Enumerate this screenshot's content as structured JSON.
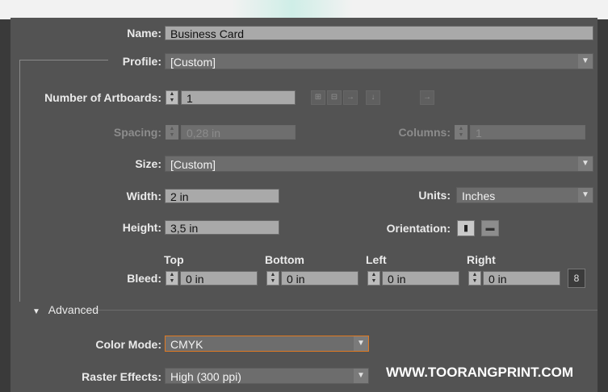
{
  "form": {
    "name": {
      "label": "Name:",
      "value": "Business Card"
    },
    "profile": {
      "label": "Profile:",
      "value": "[Custom]"
    },
    "artboards": {
      "label": "Number of Artboards:",
      "value": "1"
    },
    "spacing": {
      "label": "Spacing:",
      "value": "0,28 in"
    },
    "columns": {
      "label": "Columns:",
      "value": "1"
    },
    "size": {
      "label": "Size:",
      "value": "[Custom]"
    },
    "width": {
      "label": "Width:",
      "value": "2 in"
    },
    "units": {
      "label": "Units:",
      "value": "Inches"
    },
    "height": {
      "label": "Height:",
      "value": "3,5 in"
    },
    "orientation": {
      "label": "Orientation:"
    },
    "bleed": {
      "label": "Bleed:",
      "top": {
        "label": "Top",
        "value": "0 in"
      },
      "bottom": {
        "label": "Bottom",
        "value": "0 in"
      },
      "left": {
        "label": "Left",
        "value": "0 in"
      },
      "right": {
        "label": "Right",
        "value": "0 in"
      }
    },
    "advanced": {
      "label": "Advanced"
    },
    "color_mode": {
      "label": "Color Mode:",
      "value": "CMYK"
    },
    "raster_effects": {
      "label": "Raster Effects:",
      "value": "High (300 ppi)"
    }
  },
  "watermark": "WWW.TOORANGPRINT.COM",
  "icons": [
    "grid-by-row-icon",
    "grid-by-column-icon",
    "arrange-by-row-icon",
    "arrange-by-column-icon",
    "right-to-left-icon",
    "portrait-icon",
    "landscape-icon",
    "link-icon",
    "spin-arrows-icon",
    "dropdown-arrow-icon",
    "disclosure-triangle-icon"
  ],
  "colors": {
    "panel": "#535353",
    "field": "#a9a9a9",
    "highlight": "#e07a22"
  }
}
